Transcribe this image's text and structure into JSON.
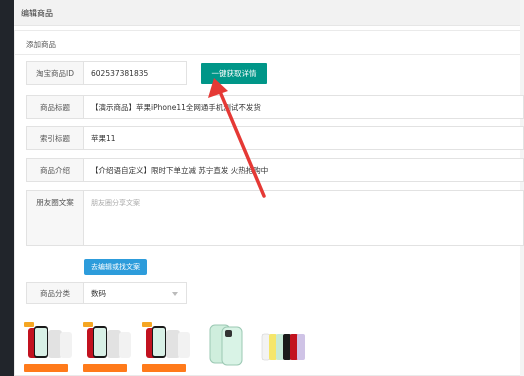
{
  "header": {
    "title": "编辑商品"
  },
  "card": {
    "title": "添加商品"
  },
  "form": {
    "taobao_id": {
      "label": "淘宝商品ID",
      "value": "602537381835"
    },
    "fetch_button": "一键获取详情",
    "title_field": {
      "label": "商品标题",
      "value": "【演示商品】苹果iPhone11全网通手机测试不发货"
    },
    "index_title": {
      "label": "索引标题",
      "value": "苹果11"
    },
    "intro": {
      "label": "商品介绍",
      "value": "【介绍语自定义】限时下单立减 苏宁直发 火热抢购中"
    },
    "moments": {
      "label": "朋友圈文案",
      "placeholder": "朋友圈分享文案"
    },
    "edit_copy_button": "去编辑或找文案",
    "category": {
      "label": "商品分类",
      "value": "数码"
    }
  },
  "thumbnails": [
    {
      "name": "iphone-red-promo",
      "colors": [
        "#c2121f",
        "#1a1a1a",
        "#d8f0e6",
        "#f2f2f2"
      ]
    },
    {
      "name": "iphone-red-promo-2",
      "colors": [
        "#c2121f",
        "#1a1a1a",
        "#d8f0e6",
        "#f2f2f2"
      ]
    },
    {
      "name": "iphone-red-promo-3",
      "colors": [
        "#c2121f",
        "#1a1a1a",
        "#d8f0e6",
        "#f2f2f2"
      ]
    },
    {
      "name": "iphone-green",
      "colors": [
        "#cfeedd"
      ]
    },
    {
      "name": "iphone-lineup",
      "colors": [
        "#ffffff",
        "#f5e66b",
        "#c7ead7",
        "#1a1a1a",
        "#c2121f",
        "#cfc3e6"
      ]
    }
  ],
  "colors": {
    "accent_green": "#009688",
    "accent_blue": "#2d9cdb",
    "arrow_red": "#e53935",
    "sidebar": "#21252b"
  }
}
